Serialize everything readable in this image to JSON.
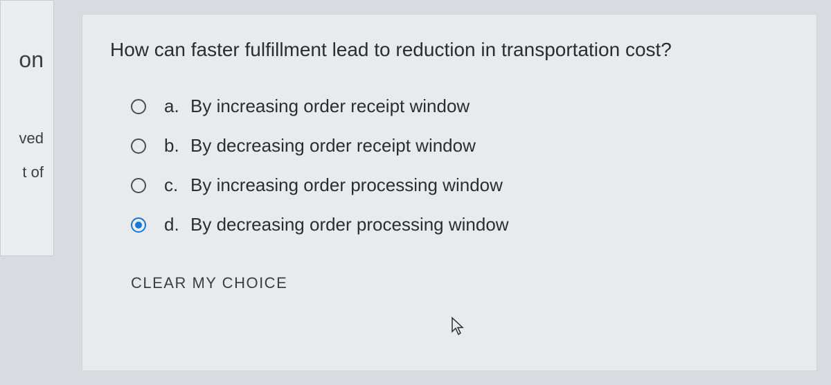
{
  "sidebar": {
    "items": [
      {
        "label": "on"
      },
      {
        "label": "ved"
      },
      {
        "label": "t of"
      }
    ]
  },
  "question": {
    "text": "How can faster fulfillment lead to reduction in transportation cost?",
    "options": [
      {
        "letter": "a.",
        "text": "By increasing order receipt window",
        "selected": false
      },
      {
        "letter": "b.",
        "text": "By decreasing order receipt window",
        "selected": false
      },
      {
        "letter": "c.",
        "text": "By increasing order processing window",
        "selected": false
      },
      {
        "letter": "d.",
        "text": "By decreasing order processing window",
        "selected": true
      }
    ],
    "clear_label": "CLEAR MY CHOICE"
  }
}
